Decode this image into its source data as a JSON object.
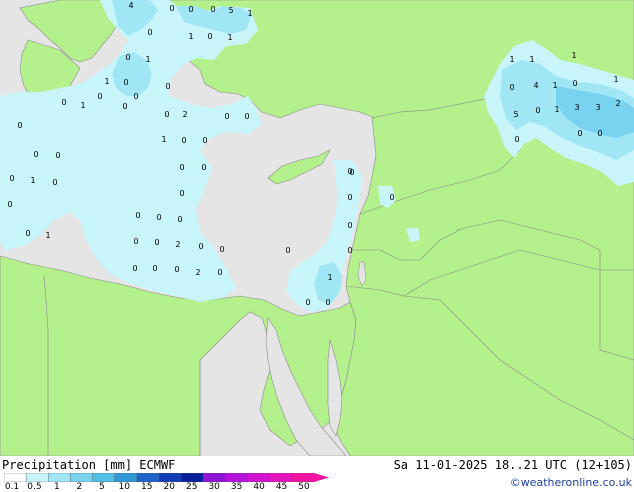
{
  "header": {
    "title": "Precipitation [mm]  ECMWF",
    "datetime": "Sa 11-01-2025 18..21 UTC (12+105)",
    "credit": "©weatheronline.co.uk"
  },
  "legend": {
    "ticks": [
      "0.1",
      "0.5",
      "1",
      "2",
      "5",
      "10",
      "15",
      "20",
      "25",
      "30",
      "35",
      "40",
      "45",
      "50"
    ],
    "colors": [
      "#ffffff",
      "#c8f5fa",
      "#a0e6f5",
      "#78d2f0",
      "#50bee6",
      "#3296d2",
      "#1e64c8",
      "#143cb4",
      "#0a1e9b",
      "#8c14d2",
      "#b414dc",
      "#d214d2",
      "#e614be",
      "#f014a0"
    ]
  },
  "colors": {
    "land": "#b4f08c",
    "sea": "#e5e5e5",
    "precip_light": "#c8f5fa",
    "precip_medium": "#a0e6f5",
    "precip_heavy": "#78d2f0",
    "border": "#8c8c8c"
  },
  "map_labels": [
    "4",
    "0",
    "0",
    "0",
    "5",
    "1",
    "0",
    "1",
    "0",
    "1",
    "0",
    "1",
    "1",
    "0",
    "0",
    "0",
    "0",
    "1",
    "0",
    "0",
    "0",
    "2",
    "0",
    "0",
    "0",
    "1",
    "0",
    "0",
    "0",
    "0",
    "0",
    "1",
    "0",
    "0",
    "0",
    "0",
    "0",
    "0",
    "0",
    "0",
    "0",
    "1",
    "0",
    "0",
    "2",
    "0",
    "0",
    "0",
    "0",
    "0",
    "0",
    "0",
    "0",
    "0",
    "0",
    "0",
    "2",
    "0",
    "1",
    "0",
    "0",
    "0",
    "1",
    "1",
    "1",
    "4",
    "1",
    "0",
    "0",
    "3",
    "0",
    "1",
    "3",
    "2",
    "5",
    "0",
    "0",
    "1",
    "0"
  ]
}
